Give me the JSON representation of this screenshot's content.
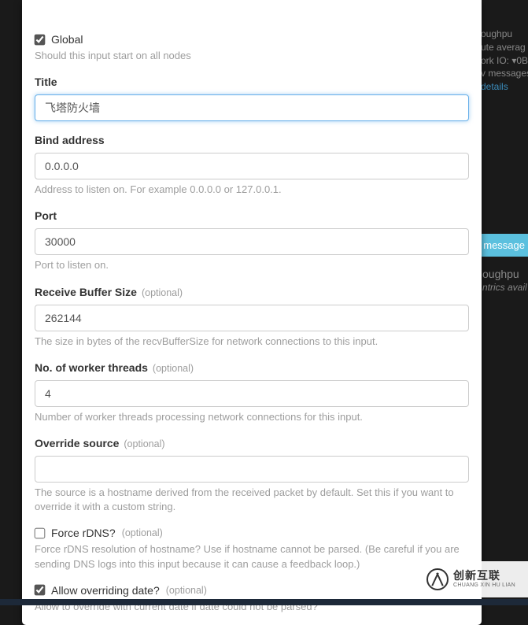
{
  "background": {
    "throughput1": "oughpu",
    "line1": "ute averag",
    "line2": "ork IO: ▾0B",
    "line3": "v messages",
    "details": "details",
    "msgbtn": "message",
    "throughput2": "oughpu",
    "metrics": "ntrics avail"
  },
  "global": {
    "label": "Global",
    "checked": true,
    "help": "Should this input start on all nodes"
  },
  "title": {
    "label": "Title",
    "value": "飞塔防火墙"
  },
  "bind": {
    "label": "Bind address",
    "value": "0.0.0.0",
    "help": "Address to listen on. For example 0.0.0.0 or 127.0.0.1."
  },
  "port": {
    "label": "Port",
    "value": "30000",
    "help": "Port to listen on."
  },
  "recv": {
    "label": "Receive Buffer Size",
    "optional": "(optional)",
    "value": "262144",
    "help": "The size in bytes of the recvBufferSize for network connections to this input."
  },
  "workers": {
    "label": "No. of worker threads",
    "optional": "(optional)",
    "value": "4",
    "help": "Number of worker threads processing network connections for this input."
  },
  "override": {
    "label": "Override source",
    "optional": "(optional)",
    "value": "",
    "help": "The source is a hostname derived from the received packet by default. Set this if you want to override it with a custom string."
  },
  "rdns": {
    "label": "Force rDNS?",
    "optional": "(optional)",
    "checked": false,
    "help": "Force rDNS resolution of hostname? Use if hostname cannot be parsed. (Be careful if you are sending DNS logs into this input because it can cause a feedback loop.)"
  },
  "allowdate": {
    "label": "Allow overriding date?",
    "optional": "(optional)",
    "checked": true,
    "help": "Allow to override with current date if date could not be parsed?"
  },
  "watermark": {
    "cn": "创新互联",
    "en": "CHUANG XIN HU LIAN"
  }
}
